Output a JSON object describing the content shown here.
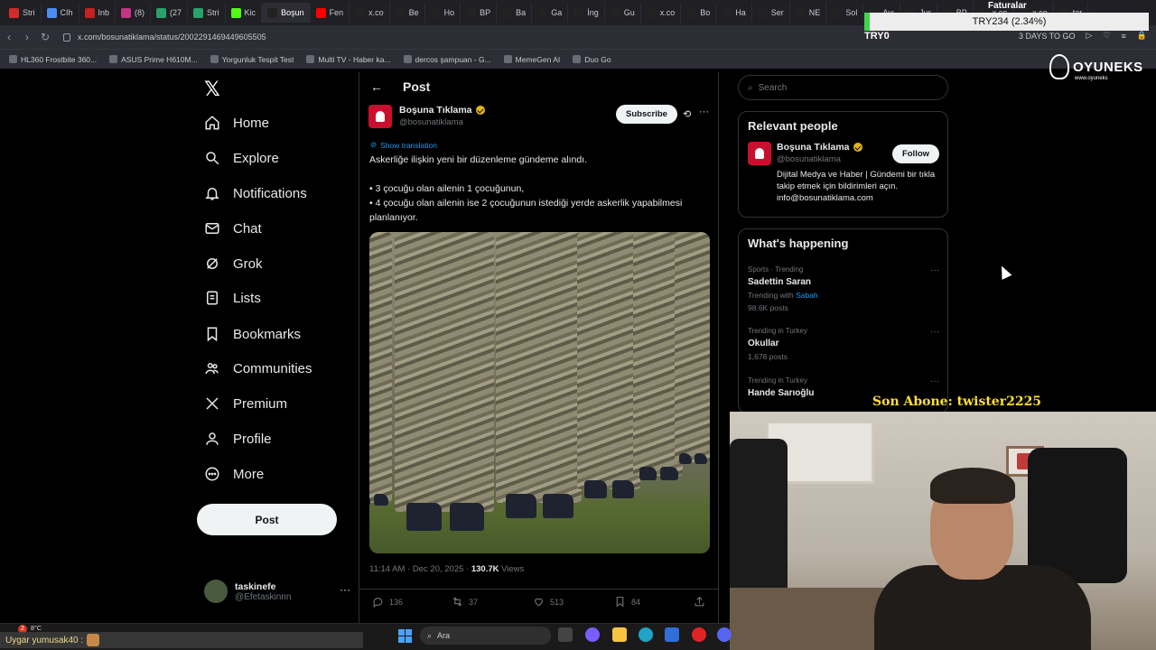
{
  "browser": {
    "tabs": [
      {
        "label": "Stri",
        "color": "#d12b2b"
      },
      {
        "label": "CIh",
        "color": "#4b8bf4"
      },
      {
        "label": "Inb",
        "color": "#c5221f"
      },
      {
        "label": "(8)",
        "color": "#c13584"
      },
      {
        "label": "(27",
        "color": "#2aa16a"
      },
      {
        "label": "Stri",
        "color": "#2aa16a"
      },
      {
        "label": "Kic",
        "color": "#53fc18"
      },
      {
        "label": "Boşun",
        "color": "#222"
      },
      {
        "label": "Fen",
        "color": "#ff0000"
      },
      {
        "label": "x.co",
        "color": "#222"
      },
      {
        "label": "Be",
        "color": "#222"
      },
      {
        "label": "Ho",
        "color": "#222"
      },
      {
        "label": "BP",
        "color": "#222"
      },
      {
        "label": "Ba",
        "color": "#222"
      },
      {
        "label": "Ga",
        "color": "#222"
      },
      {
        "label": "İng",
        "color": "#222"
      },
      {
        "label": "Gu",
        "color": "#222"
      },
      {
        "label": "x.co",
        "color": "#222"
      },
      {
        "label": "Bo",
        "color": "#222"
      },
      {
        "label": "Ha",
        "color": "#222"
      },
      {
        "label": "Ser",
        "color": "#222"
      },
      {
        "label": "NE",
        "color": "#222"
      },
      {
        "label": "Sol",
        "color": "#222"
      },
      {
        "label": "Ayı",
        "color": "#222"
      },
      {
        "label": "Jur",
        "color": "#222"
      },
      {
        "label": "BP",
        "color": "#222"
      },
      {
        "label": "x.co",
        "color": "#222"
      },
      {
        "label": "x.co",
        "color": "#222"
      },
      {
        "label": "tar",
        "color": "#222"
      }
    ],
    "active_tab_index": 7,
    "url": "x.com/bosunatiklama/status/2002291469449605505",
    "days_badge": "3 DAYS TO GO",
    "bookmarks": [
      "HL360 Frostbite 360...",
      "ASUS Prime H610M...",
      "Yorgunluk Tespit Test",
      "Multi TV - Haber ka...",
      "dercos şampuan - G...",
      "MemeGen AI",
      "Duo Go"
    ]
  },
  "nav": {
    "items": [
      {
        "label": "Home",
        "icon": "home-icon"
      },
      {
        "label": "Explore",
        "icon": "search-icon"
      },
      {
        "label": "Notifications",
        "icon": "bell-icon"
      },
      {
        "label": "Chat",
        "icon": "mail-icon"
      },
      {
        "label": "Grok",
        "icon": "grok-icon"
      },
      {
        "label": "Lists",
        "icon": "list-icon"
      },
      {
        "label": "Bookmarks",
        "icon": "bookmark-icon"
      },
      {
        "label": "Communities",
        "icon": "people-icon"
      },
      {
        "label": "Premium",
        "icon": "x-logo-icon"
      },
      {
        "label": "Profile",
        "icon": "user-icon"
      },
      {
        "label": "More",
        "icon": "more-circle-icon"
      }
    ],
    "post_button": "Post",
    "account": {
      "name": "taskinefe",
      "handle": "@Efetaskinnn"
    }
  },
  "post": {
    "header": "Post",
    "author_name": "Boşuna Tıklama",
    "author_handle": "@bosunatiklama",
    "subscribe_label": "Subscribe",
    "show_translation": "Show translation",
    "text_line1": "Askerliğe ilişkin yeni bir düzenleme gündeme alındı.",
    "text_line2": "• 3 çocuğu olan ailenin 1 çocuğunun,",
    "text_line3": "• 4 çocuğu olan ailenin ise 2 çocuğunun istediği yerde askerlik yapabilmesi planlanıyor.",
    "timestamp": "11:14 AM · Dec 20, 2025 · ",
    "views_count": "130.7K",
    "views_label": "Views",
    "replies": "136",
    "reposts": "37",
    "likes": "513",
    "bookmarks": "84"
  },
  "sidebar": {
    "search_placeholder": "Search",
    "relevant_title": "Relevant people",
    "person_name": "Boşuna Tıklama",
    "person_handle": "@bosunatiklama",
    "follow_label": "Follow",
    "person_bio": "Dijital Medya ve Haber | Gündemi bir tıkla takip etmek için bildirimleri açın. info@bosunatiklama.com",
    "happening_title": "What's happening",
    "trends": [
      {
        "meta": "Sports · Trending",
        "name": "Sadettin Saran",
        "with_prefix": "Trending with ",
        "with_link": "Sabah",
        "posts": "98.6K posts"
      },
      {
        "meta": "Trending in Turkey",
        "name": "Okullar",
        "posts": "1,678 posts"
      },
      {
        "meta": "Trending in Turkey",
        "name": "Hande Sarıoğlu",
        "posts": ""
      }
    ]
  },
  "overlay": {
    "ticker_title": "Faturalar",
    "ticker_value": "TRY234 (2.34%)",
    "try_label": "TRY0",
    "brand": "OYUNEKS",
    "brand_sub": "www.oyuneks",
    "last_sub_label": "Son Abone: twister2225",
    "chat_line": "Uygar yumusak40 :",
    "weather": "8°C",
    "notif_count": "2",
    "taskbar_search": "Ara"
  }
}
